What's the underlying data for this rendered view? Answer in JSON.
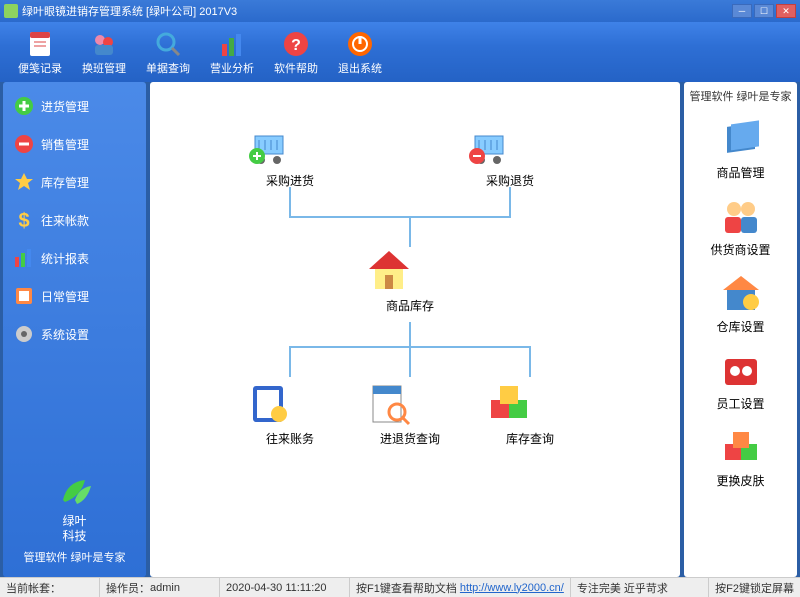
{
  "window": {
    "title": "绿叶眼镜进销存管理系统 [绿叶公司] 2017V3"
  },
  "toolbar": [
    {
      "id": "note-record",
      "label": "便笺记录"
    },
    {
      "id": "shift-mgmt",
      "label": "换班管理"
    },
    {
      "id": "bill-query",
      "label": "单据查询"
    },
    {
      "id": "biz-analysis",
      "label": "营业分析"
    },
    {
      "id": "help",
      "label": "软件帮助"
    },
    {
      "id": "exit",
      "label": "退出系统"
    }
  ],
  "leftMenu": [
    {
      "id": "purchase",
      "label": "进货管理"
    },
    {
      "id": "sales",
      "label": "销售管理"
    },
    {
      "id": "stock",
      "label": "库存管理"
    },
    {
      "id": "accounts",
      "label": "往来帐款"
    },
    {
      "id": "reports",
      "label": "统计报表"
    },
    {
      "id": "daily",
      "label": "日常管理"
    },
    {
      "id": "settings",
      "label": "系统设置"
    }
  ],
  "brand": {
    "name": "绿叶\n科技",
    "slogan": "管理软件 绿叶是专家"
  },
  "flow": {
    "purchaseIn": "采购进货",
    "purchaseReturn": "采购退货",
    "goodsStock": "商品库存",
    "arap": "往来账务",
    "inOutQuery": "进退货查询",
    "stockQuery": "库存查询"
  },
  "rightPanel": {
    "title": "管理软件 绿叶是专家",
    "items": [
      {
        "id": "goods-mgmt",
        "label": "商品管理"
      },
      {
        "id": "supplier",
        "label": "供货商设置"
      },
      {
        "id": "warehouse",
        "label": "仓库设置"
      },
      {
        "id": "staff",
        "label": "员工设置"
      },
      {
        "id": "skin",
        "label": "更换皮肤"
      }
    ]
  },
  "status": {
    "account": "当前帐套：",
    "operatorLabel": "操作员：",
    "operator": "admin",
    "datetime": "2020-04-30 11:11:20",
    "helpHint": "按F1键查看帮助文档",
    "url": "http://www.ly2000.cn/",
    "motto": "专注完美 近乎苛求",
    "lockHint": "按F2键锁定屏幕"
  }
}
